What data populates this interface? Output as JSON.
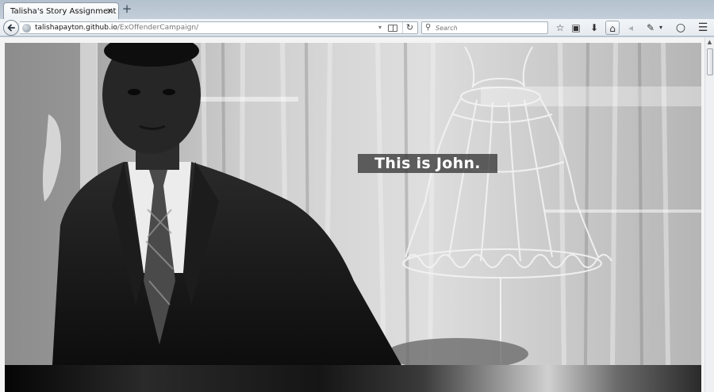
{
  "tab": {
    "title": "Talisha's Story Assignment",
    "close_glyph": "×"
  },
  "new_tab_glyph": "+",
  "nav": {
    "url_host": "talishapayton.github.io",
    "url_path": "/ExOffenderCampaign/",
    "search_placeholder": "Search",
    "back_icon": "back-arrow-icon",
    "reload_glyph": "↻",
    "dropdown_glyph": "▾",
    "search_glyph": "⚲"
  },
  "toolbar": {
    "bookmark_glyph": "☆",
    "library_glyph": "▣",
    "download_glyph": "⬇",
    "home_glyph": "⌂",
    "share_glyph": "◂",
    "devtools_glyph": "✎",
    "chevron_glyph": "▾",
    "chat_glyph": "○",
    "menu_glyph": "☰"
  },
  "page": {
    "caption": "This is John."
  },
  "colors": {
    "caption_bg": "#373737",
    "caption_text": "#ffffff"
  }
}
